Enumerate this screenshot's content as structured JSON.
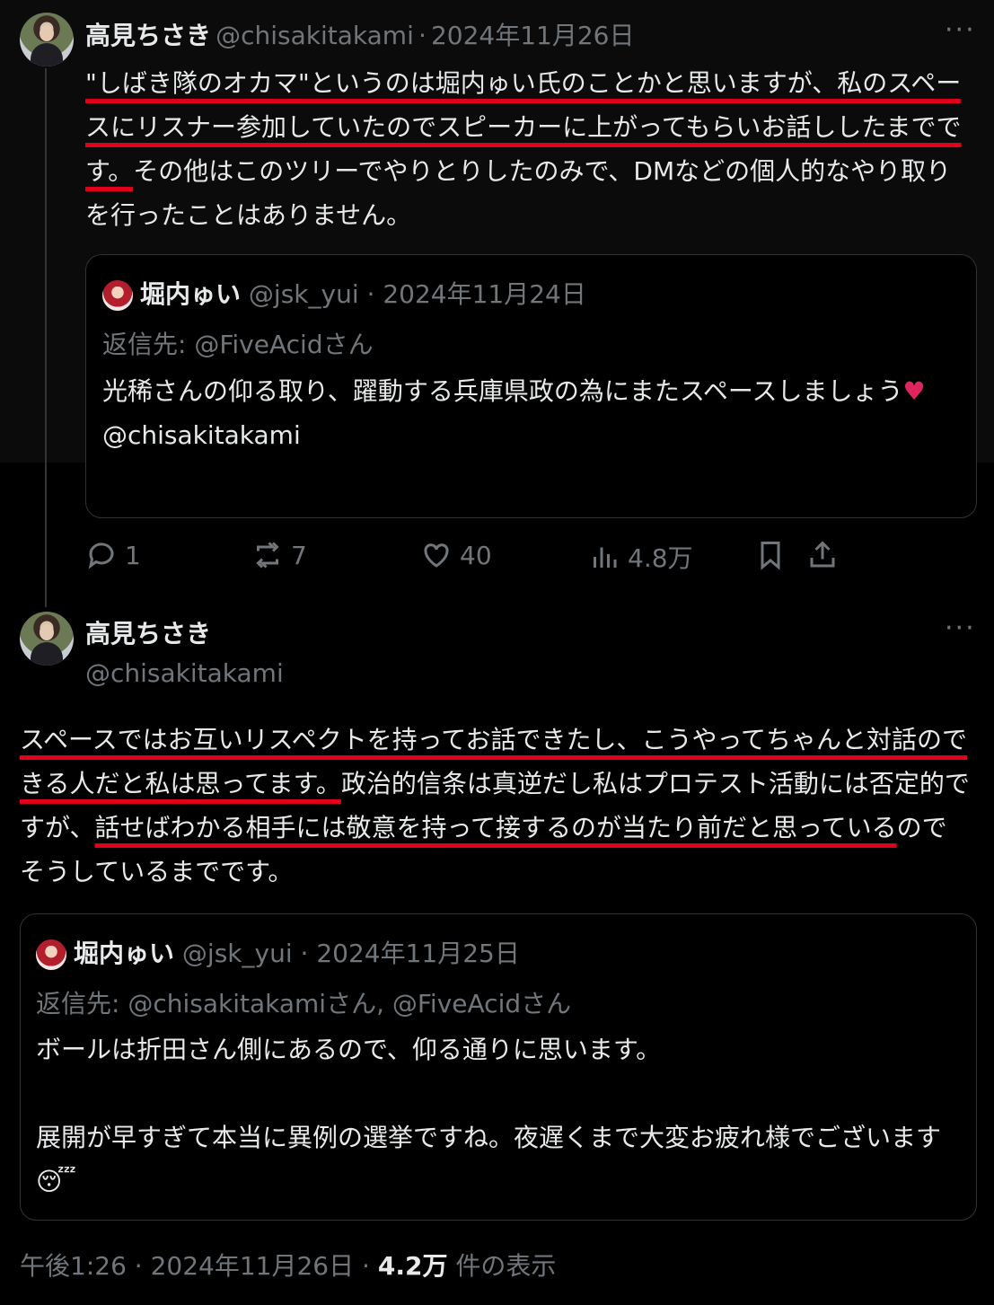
{
  "post1": {
    "author_name": "高見ちさき",
    "author_handle": "@chisakitakami",
    "date": "2024年11月26日",
    "more": "···",
    "text_u1": "\"しばき隊のオカマ\"というのは堀内ゅい氏のことかと思いますが、私のスペースにリスナー参加していたのでスピーカーに上がってもらいお話ししたまでです。",
    "text_rest": "その他はこのツリーでやりとりしたのみで、DMなどの個人的なやり取りを行ったことはありません。",
    "quote": {
      "name": "堀内ゅい",
      "handle": "@jsk_yui",
      "date": "2024年11月24日",
      "reply_to": "返信先: @FiveAcidさん",
      "body": "光稀さんの仰る取り、躍動する兵庫県政の為にまたスペースしましょう",
      "heart": "♥",
      "mention": "@chisakitakami"
    },
    "actions": {
      "reply_count": "1",
      "repost_count": "7",
      "like_count": "40",
      "views_count": "4.8万"
    }
  },
  "post2": {
    "author_name": "高見ちさき",
    "author_handle": "@chisakitakami",
    "more": "···",
    "text_u1": "スペースではお互いリスペクトを持ってお話できたし、こうやってちゃんと対話のできる人だと私は思ってます。",
    "text_mid": "政治的信条は真逆だし私はプロテスト活動には否定的ですが、",
    "text_u2": "話せばわかる相手には敬意を持って接するのが当たり前だと思っている",
    "text_end": "のでそうしているまでです。",
    "quote": {
      "name": "堀内ゅい",
      "handle": "@jsk_yui",
      "date": "2024年11月25日",
      "reply_to": "返信先: @chisakitakamiさん, @FiveAcidさん",
      "body1": "ボールは折田さん側にあるので、仰る通りに思います。",
      "body2": "展開が早すぎて本当に異例の選挙ですね。夜遅くまで大変お疲れ様でございます",
      "emoji": "😴"
    },
    "footer": {
      "time": "午後1:26",
      "date": "2024年11月26日",
      "views": "4.2万",
      "views_label": "件の表示"
    }
  }
}
